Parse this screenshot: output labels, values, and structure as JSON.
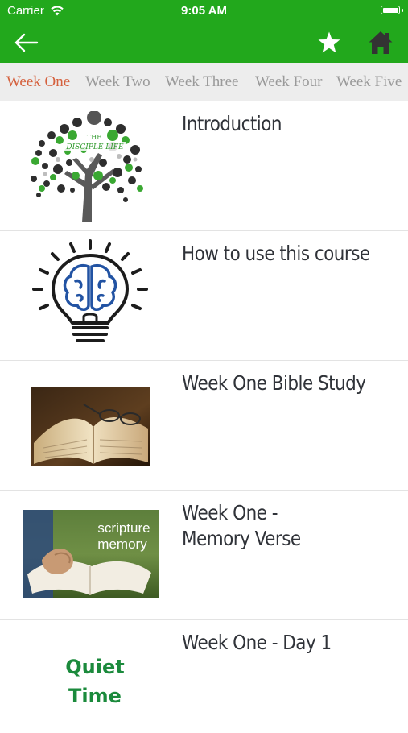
{
  "status_bar": {
    "carrier": "Carrier",
    "time": "9:05 AM"
  },
  "nav": {
    "back_icon": "arrow-left-icon",
    "favorite_icon": "star-icon",
    "home_icon": "home-icon"
  },
  "colors": {
    "header_green": "#22a81c",
    "active_tab": "#d5613e",
    "inactive_tab": "#9a9a9a",
    "title_text": "#303339",
    "quiet_time_green": "#1b8a3c"
  },
  "tabs": [
    {
      "label": "Week One",
      "active": true
    },
    {
      "label": "Week Two",
      "active": false
    },
    {
      "label": "Week Three",
      "active": false
    },
    {
      "label": "Week Four",
      "active": false
    },
    {
      "label": "Week Five",
      "active": false
    }
  ],
  "lessons": [
    {
      "title": "Introduction",
      "thumbnail": "disciple-life-tree-logo",
      "logo_text": [
        "THE",
        "DISCIPLE LIFE"
      ]
    },
    {
      "title": "How to use this course",
      "thumbnail": "lightbulb-brain-icon"
    },
    {
      "title": "Week One Bible Study",
      "thumbnail": "open-bible-photo"
    },
    {
      "title": "Week One -\nMemory Verse",
      "line1": "Week One -",
      "line2": "Memory Verse",
      "thumbnail": "scripture-memory-photo",
      "image_text": [
        "scripture",
        "memory"
      ]
    },
    {
      "title": "Week One - Day 1",
      "thumbnail": "quiet-time-logo",
      "image_text": [
        "Quiet",
        "Time"
      ]
    }
  ]
}
